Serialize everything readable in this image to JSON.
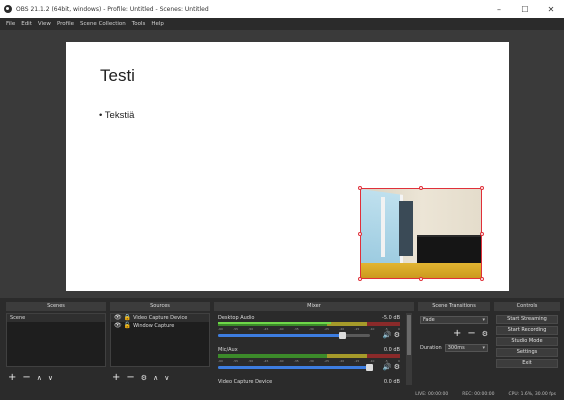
{
  "window": {
    "title": "OBS 21.1.2 (64bit, windows) - Profile: Untitled - Scenes: Untitled",
    "minimize": "–",
    "maximize": "☐",
    "close": "✕"
  },
  "menu": [
    "File",
    "Edit",
    "View",
    "Profile",
    "Scene Collection",
    "Tools",
    "Help"
  ],
  "preview": {
    "slide_title": "Testi",
    "slide_bullet": "• Tekstiä"
  },
  "docks": {
    "scenes": {
      "header": "Scenes",
      "items": [
        "Scene"
      ],
      "toolbar": [
        "+",
        "−",
        "∧",
        "∨"
      ]
    },
    "sources": {
      "header": "Sources",
      "items": [
        {
          "eye": "👁",
          "lock": "🔒",
          "label": "Video Capture Device"
        },
        {
          "eye": "👁",
          "lock": "🔓",
          "label": "Window Capture"
        }
      ],
      "toolbar": [
        "+",
        "−",
        "⚙",
        "∧",
        "∨"
      ]
    },
    "mixer": {
      "header": "Mixer",
      "channels": [
        {
          "name": "Desktop Audio",
          "db": "-5.0 dB",
          "level": 0.62,
          "volume": 0.82
        },
        {
          "name": "Mic/Aux",
          "db": "0.0 dB",
          "level": 0.0,
          "volume": 1.0
        },
        {
          "name": "Video Capture Device",
          "db": "0.0 dB",
          "level": 0.0,
          "volume": 1.0
        }
      ],
      "ticks": [
        "-60",
        "-55",
        "-50",
        "-45",
        "-40",
        "-35",
        "-30",
        "-25",
        "-20",
        "-15",
        "-10",
        "-5",
        "0"
      ]
    },
    "transitions": {
      "header": "Scene Transitions",
      "selected": "Fade",
      "duration_label": "Duration",
      "duration_value": "300ms",
      "add": "+",
      "remove": "−",
      "settings": "⚙"
    },
    "controls": {
      "header": "Controls",
      "buttons": [
        "Start Streaming",
        "Start Recording",
        "Studio Mode",
        "Settings",
        "Exit"
      ]
    }
  },
  "status": {
    "live": "LIVE: 00:00:00",
    "rec": "REC: 00:00:00",
    "cpu": "CPU: 1.6%, 30.00 fps"
  }
}
